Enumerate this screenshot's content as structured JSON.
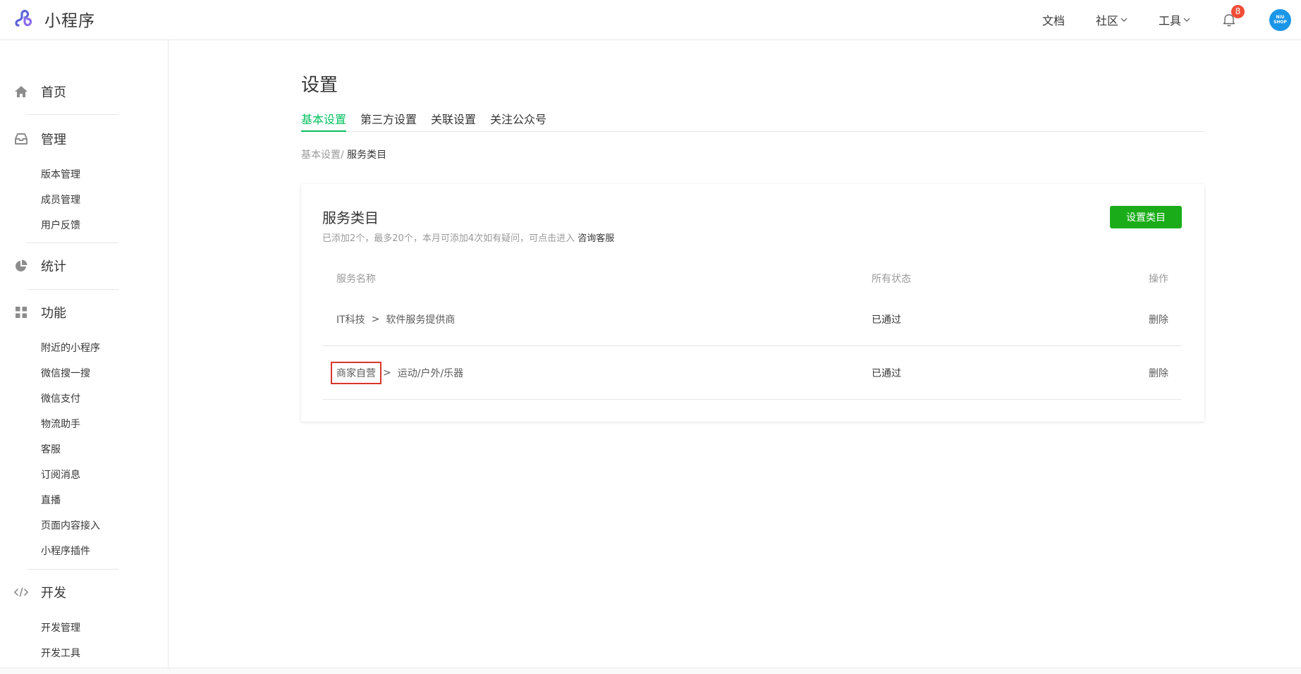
{
  "header": {
    "app_name": "小程序",
    "logo_icon": "miniprogram-logo-icon",
    "nav": {
      "docs": "文档",
      "community": "社区",
      "tools": "工具"
    },
    "notification_count": "8",
    "avatar_text_top": "NiU",
    "avatar_text_bottom": "SHOP"
  },
  "sidebar": {
    "home": "首页",
    "manage": "管理",
    "manage_items": [
      "版本管理",
      "成员管理",
      "用户反馈"
    ],
    "stats": "统计",
    "features": "功能",
    "feature_items": [
      "附近的小程序",
      "微信搜一搜",
      "微信支付",
      "物流助手",
      "客服",
      "订阅消息",
      "直播",
      "页面内容接入",
      "小程序插件"
    ],
    "dev": "开发",
    "dev_items": [
      "开发管理",
      "开发工具"
    ]
  },
  "main": {
    "title": "设置",
    "tabs": [
      "基本设置",
      "第三方设置",
      "关联设置",
      "关注公众号"
    ],
    "active_tab": 0,
    "breadcrumb": {
      "parent": "基本设置/",
      "current": " 服务类目"
    }
  },
  "card": {
    "title": "服务类目",
    "description": "已添加2个，最多20个，本月可添加4次如有疑问，可点击进入 ",
    "support_link": "咨询客服",
    "set_button": "设置类目",
    "columns": {
      "name": "服务名称",
      "status": "所有状态",
      "action": "操作"
    },
    "rows": [
      {
        "category": "IT科技",
        "separator": ">",
        "subcategory": "软件服务提供商",
        "status": "已通过",
        "action": "删除"
      },
      {
        "category": "商家自营",
        "separator": ">",
        "subcategory": "运动/户外/乐器",
        "status": "已通过",
        "action": "删除"
      }
    ]
  },
  "colors": {
    "accent_green": "#07c160",
    "button_green": "#1aad19",
    "badge_red": "#f04e37",
    "highlight_red": "#d9362b"
  }
}
